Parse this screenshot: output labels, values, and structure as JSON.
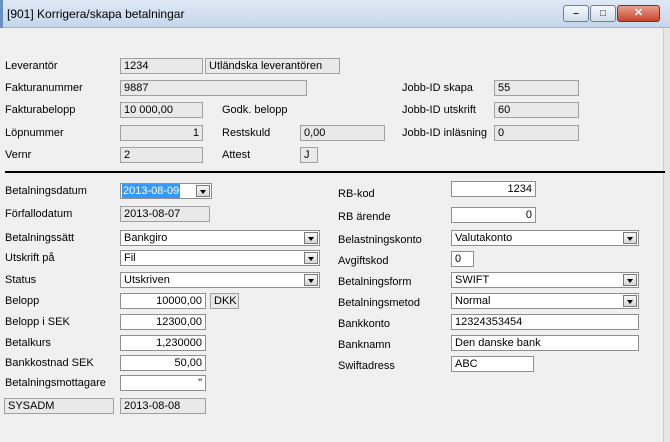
{
  "window": {
    "title": "[901]  Korrigera/skapa betalningar",
    "min_glyph": "–",
    "max_glyph": "□",
    "close_glyph": "✕"
  },
  "header": {
    "leverantor_label": "Leverantör",
    "leverantor_id": "1234",
    "leverantor_name": "Utländska leverantören",
    "fakturanummer_label": "Fakturanummer",
    "fakturanummer": "9887",
    "fakturabelopp_label": "Fakturabelopp",
    "fakturabelopp": "10 000,00",
    "godk_belopp_label": "Godk. belopp",
    "lopnummer_label": "Löpnummer",
    "lopnummer": "1",
    "restskuld_label": "Restskuld",
    "restskuld": "0,00",
    "vernr_label": "Vernr",
    "vernr": "2",
    "attest_label": "Attest",
    "attest": "J",
    "jobb_skapa_label": "Jobb-ID skapa",
    "jobb_skapa": "55",
    "jobb_utskrift_label": "Jobb-ID utskrift",
    "jobb_utskrift": "60",
    "jobb_inlasning_label": "Jobb-ID inläsning",
    "jobb_inlasning": "0"
  },
  "form": {
    "betalningsdatum_label": "Betalningsdatum",
    "betalningsdatum": "2013-08-09",
    "forfallodatum_label": "Förfallodatum",
    "forfallodatum": "2013-08-07",
    "betalningssatt_label": "Betalningssätt",
    "betalningssatt": "Bankgiro",
    "utskrift_label": "Utskrift på",
    "utskrift": "Fil",
    "status_label": "Status",
    "status": "Utskriven",
    "belopp_label": "Belopp",
    "belopp": "10000,00",
    "valuta": "DKK",
    "belopp_sek_label": "Belopp i SEK",
    "belopp_sek": "12300,00",
    "betalkurs_label": "Betalkurs",
    "betalkurs": "1,230000",
    "bankkostnad_label": "Bankkostnad SEK",
    "bankkostnad": "50,00",
    "mottagare_label": "Betalningsmottagare",
    "mottagare": "\"",
    "user": "SYSADM",
    "user_date": "2013-08-08",
    "rbkod_label": "RB-kod",
    "rbkod": "1234",
    "rbarende_label": "RB ärende",
    "rbarende": "0",
    "belastningskonto_label": "Belastningskonto",
    "belastningskonto": "Valutakonto",
    "avgiftskod_label": "Avgiftskod",
    "avgiftskod": "0",
    "betalningsform_label": "Betalningsform",
    "betalningsform": "SWIFT",
    "betalningsmetod_label": "Betalningsmetod",
    "betalningsmetod": "Normal",
    "bankkonto_label": "Bankkonto",
    "bankkonto": "12324353454",
    "banknamn_label": "Banknamn",
    "banknamn": "Den danske bank",
    "swiftadress_label": "Swiftadress",
    "swiftadress": "ABC"
  }
}
